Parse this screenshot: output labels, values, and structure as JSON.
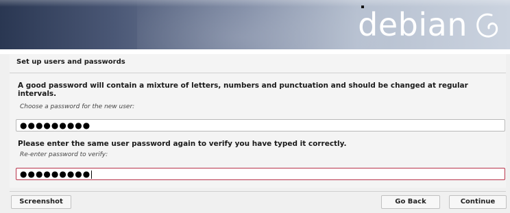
{
  "banner": {
    "logo_text": "debian",
    "logo_icon": "debian-swirl-icon"
  },
  "page": {
    "title": "Set up users and passwords"
  },
  "password": {
    "instruction": "A good password will contain a mixture of letters, numbers and punctuation and should be changed at regular intervals.",
    "prompt": "Choose a password for the new user:",
    "value": "●●●●●●●●●"
  },
  "verify": {
    "instruction": "Please enter the same user password again to verify you have typed it correctly.",
    "prompt": "Re-enter password to verify:",
    "value": "●●●●●●●●●"
  },
  "buttons": {
    "screenshot": "Screenshot",
    "go_back": "Go Back",
    "continue": "Continue"
  },
  "colors": {
    "active_field_border": "#b8334a",
    "banner_dark": "#2a3752",
    "banner_light": "#cbd3df"
  }
}
